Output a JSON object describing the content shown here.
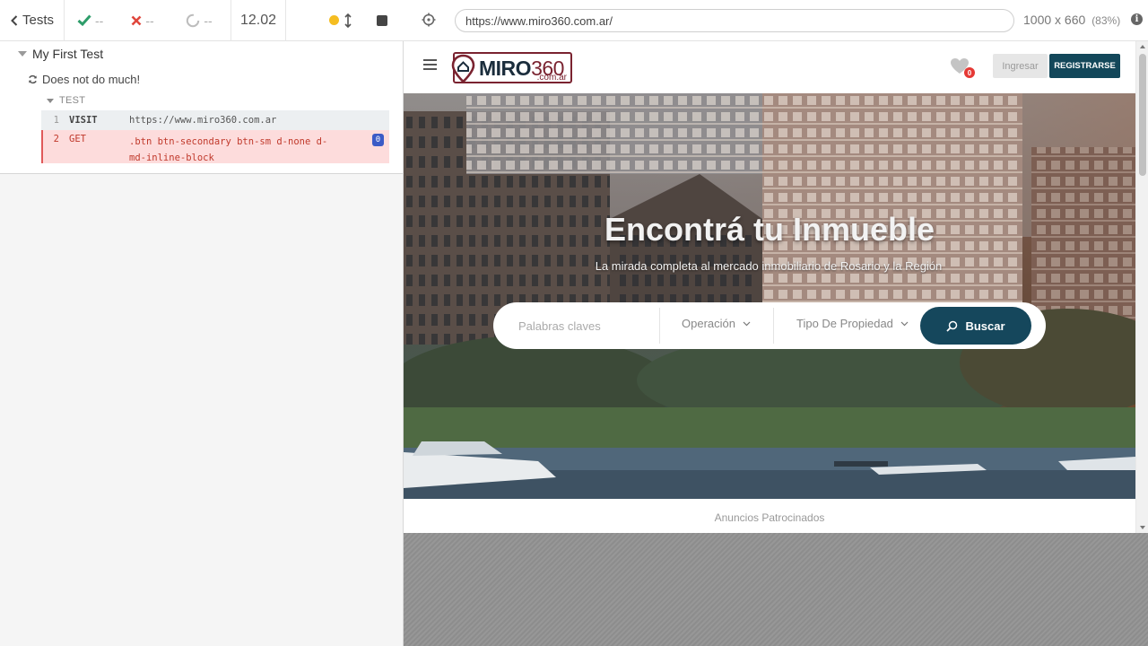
{
  "reporter": {
    "back_label": "Tests",
    "passed": "--",
    "failed": "--",
    "pending": "--",
    "duration": "12.02",
    "status_color": "#f5bd21",
    "suite_title": "My First Test",
    "test_title": "Does not do much!",
    "test_section_label": "TEST",
    "commands": [
      {
        "num": "1",
        "name": "VISIT",
        "message": "https://www.miro360.com.ar"
      },
      {
        "num": "2",
        "name": "GET",
        "message": ".btn btn-secondary btn-sm d-none d-md-inline-block",
        "badge": "0"
      }
    ]
  },
  "aut": {
    "url": "https://www.miro360.com.ar/",
    "viewport": "1000 x 660",
    "zoom": "(83%)"
  },
  "site": {
    "logo_text": "MIRO",
    "logo_num": "360",
    "logo_sub": ".com.ar",
    "favorites_count": "0",
    "login_label": "Ingresar",
    "register_label": "REGISTRARSE",
    "hero_title": "Encontrá tu Inmueble",
    "hero_subtitle": "La mirada completa al mercado inmobiliario de Rosario y la Región",
    "search_placeholder": "Palabras claves",
    "operation_label": "Operación",
    "property_type_label": "Tipo De Propiedad",
    "search_button": "Buscar",
    "sponsored_label": "Anuncios Patrocinados"
  },
  "colors": {
    "brand_dark": "#13475a",
    "brand_red": "#7a2330",
    "fail_red": "#c0392b",
    "pass_green": "#2e9d6a"
  }
}
